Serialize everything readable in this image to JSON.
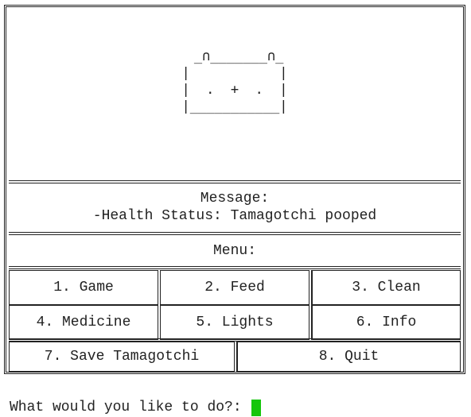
{
  "pet": {
    "sprite": " _∩_______∩_\n|           |\n|  .  +  .  |\n|___________|"
  },
  "message": {
    "title": "Message:",
    "text": "-Health Status: Tamagotchi pooped"
  },
  "menu": {
    "title": "Menu:",
    "items": [
      {
        "label": "1. Game"
      },
      {
        "label": "2. Feed"
      },
      {
        "label": "3. Clean"
      },
      {
        "label": "4. Medicine"
      },
      {
        "label": "5. Lights"
      },
      {
        "label": "6. Info"
      },
      {
        "label": "7. Save Tamagotchi"
      },
      {
        "label": "8. Quit"
      }
    ]
  },
  "prompt": {
    "text": "What would you like to do?: "
  },
  "colors": {
    "cursor": "#16c60c",
    "border": "#222222"
  }
}
